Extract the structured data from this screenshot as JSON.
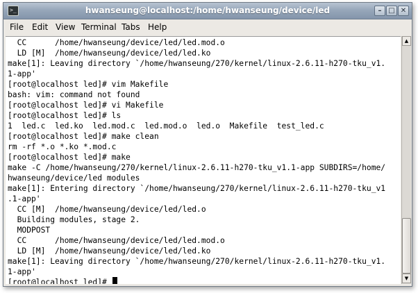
{
  "window": {
    "title": "hwanseung@localhost:/home/hwanseung/device/led",
    "minimize_glyph": "–",
    "maximize_glyph": "□",
    "close_glyph": "✕"
  },
  "menu": {
    "items": [
      {
        "label": "File"
      },
      {
        "label": "Edit"
      },
      {
        "label": "View"
      },
      {
        "label": "Terminal"
      },
      {
        "label": "Tabs"
      },
      {
        "label": "Help"
      }
    ]
  },
  "terminal": {
    "lines": [
      "  CC      /home/hwanseung/device/led/led.mod.o",
      "  LD [M]  /home/hwanseung/device/led/led.ko",
      "make[1]: Leaving directory `/home/hwanseung/270/kernel/linux-2.6.11-h270-tku_v1.",
      "1-app'",
      "[root@localhost led]# vim Makefile",
      "bash: vim: command not found",
      "[root@localhost led]# vi Makefile",
      "[root@localhost led]# ls",
      "1  led.c  led.ko  led.mod.c  led.mod.o  led.o  Makefile  test_led.c",
      "[root@localhost led]# make clean",
      "rm -rf *.o *.ko *.mod.c",
      "[root@localhost led]# make",
      "make -C /home/hwanseung/270/kernel/linux-2.6.11-h270-tku_v1.1-app SUBDIRS=/home/",
      "hwanseung/device/led modules",
      "make[1]: Entering directory `/home/hwanseung/270/kernel/linux-2.6.11-h270-tku_v1",
      ".1-app'",
      "  CC [M]  /home/hwanseung/device/led/led.o",
      "  Building modules, stage 2.",
      "  MODPOST",
      "  CC      /home/hwanseung/device/led/led.mod.o",
      "  LD [M]  /home/hwanseung/device/led/led.ko",
      "make[1]: Leaving directory `/home/hwanseung/270/kernel/linux-2.6.11-h270-tku_v1.",
      "1-app'"
    ],
    "prompt": "[root@localhost led]# "
  },
  "scrollbar": {
    "up_glyph": "▲",
    "down_glyph": "▼"
  }
}
